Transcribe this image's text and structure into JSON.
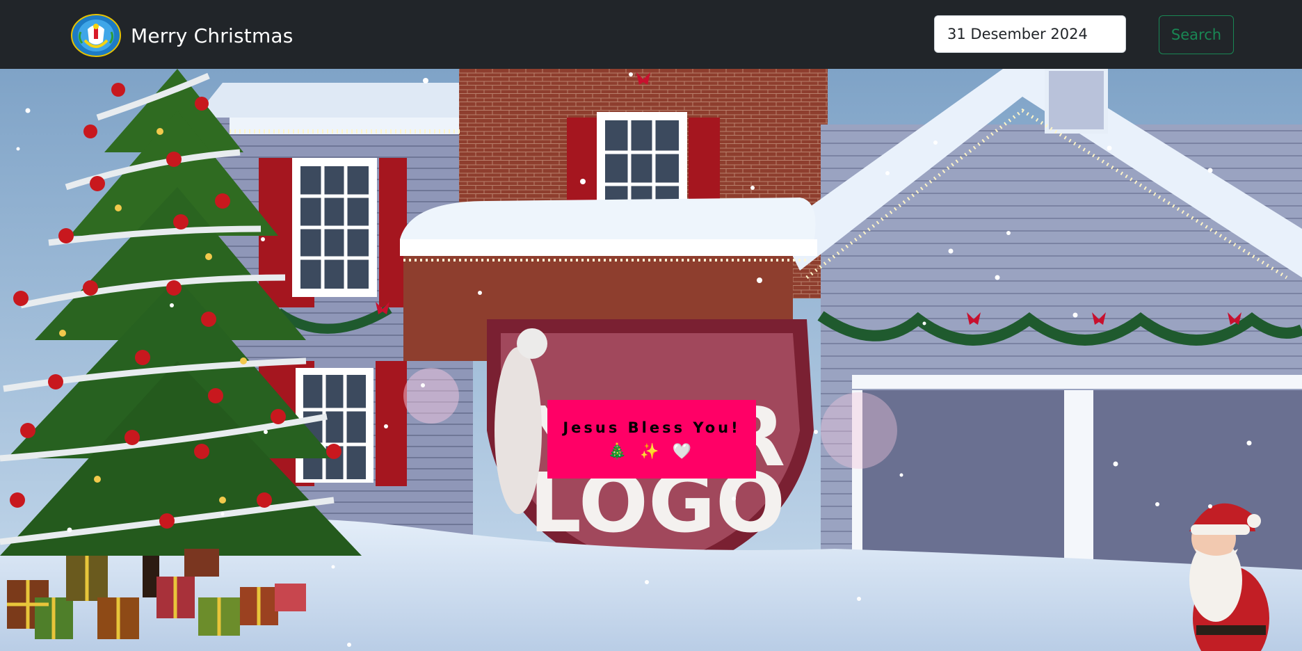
{
  "navbar": {
    "brand_title": "Merry Christmas",
    "logo_icon": "school-crest-logo-icon"
  },
  "search": {
    "value": "31 Desember 2024",
    "button_label": "Search"
  },
  "scene": {
    "description_icon": "christmas-house-video-icon",
    "sign_text": "YOUR LOGO"
  },
  "greeting": {
    "text": "Jesus Bless You!",
    "emoji": "🎄 ✨ 🤍"
  },
  "colors": {
    "navbar_bg": "#212529",
    "search_button": "#198754",
    "greeting_bg": "#ff0066"
  }
}
